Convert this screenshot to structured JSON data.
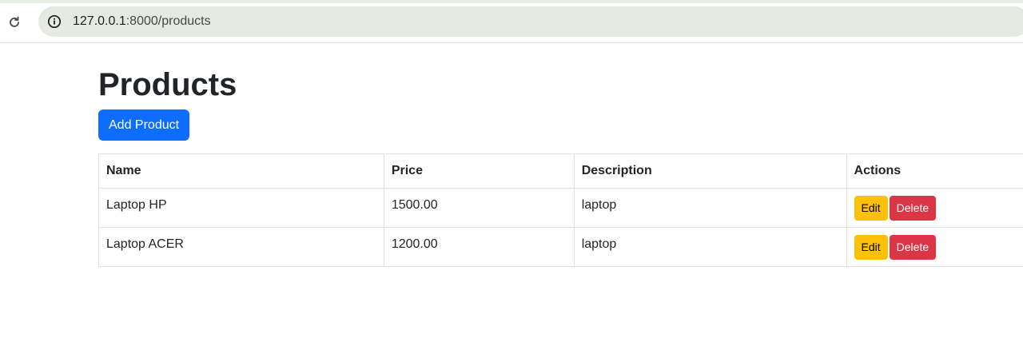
{
  "browser": {
    "url_host": "127.0.0.1",
    "url_path": ":8000/products"
  },
  "page": {
    "title": "Products",
    "add_button_label": "Add Product"
  },
  "table": {
    "headers": [
      "Name",
      "Price",
      "Description",
      "Actions"
    ],
    "rows": [
      {
        "name": "Laptop HP",
        "price": "1500.00",
        "description": "laptop",
        "edit_label": "Edit",
        "delete_label": "Delete"
      },
      {
        "name": "Laptop ACER",
        "price": "1200.00",
        "description": "laptop",
        "edit_label": "Edit",
        "delete_label": "Delete"
      }
    ]
  },
  "icons": {
    "reload": "reload-icon",
    "site_info": "info-icon"
  },
  "colors": {
    "primary": "#0d6efd",
    "warning": "#ffc107",
    "danger": "#dc3545"
  }
}
